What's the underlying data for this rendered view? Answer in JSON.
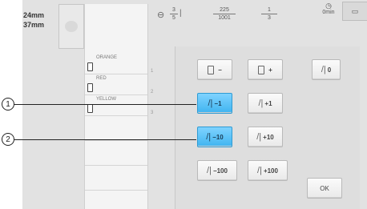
{
  "size_info": {
    "width": "24mm",
    "height": "37mm"
  },
  "thread_colors": [
    {
      "name": "ORANGE"
    },
    {
      "name": "RED"
    },
    {
      "name": "YELLOW"
    }
  ],
  "sequence_numbers": [
    "1",
    "2",
    "3"
  ],
  "top_info": {
    "stitch_fraction": {
      "num": "3",
      "den": "5"
    },
    "stitch_count": {
      "num": "225",
      "den": "1001"
    },
    "time": {
      "num": "1",
      "den": "3"
    },
    "time_total": "0min"
  },
  "buttons": {
    "minus_frame": "−",
    "plus_frame": "+",
    "needle_to_start": "0",
    "back_1": "−1",
    "forward_1": "+1",
    "back_10": "−10",
    "forward_10": "+10",
    "back_100": "−100",
    "forward_100": "+100",
    "ok": "OK"
  },
  "callouts": [
    "1",
    "2"
  ],
  "accent_color": "#3fb4f0"
}
